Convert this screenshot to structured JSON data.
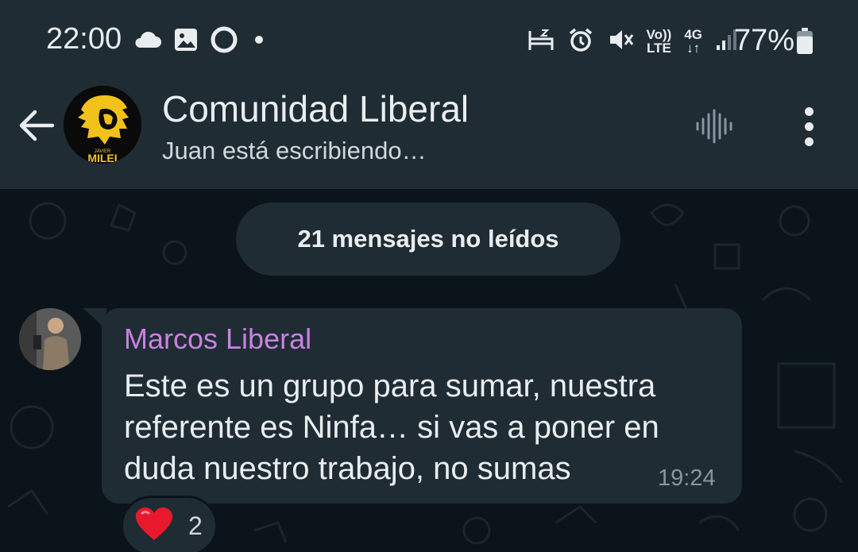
{
  "status_bar": {
    "time": "22:00",
    "left_icons": [
      "cloud-icon",
      "image-icon",
      "circle-icon",
      "dot-icon"
    ],
    "right_icons": [
      "bed-icon",
      "alarm-icon",
      "mute-icon",
      "volte-icon",
      "4g-icon",
      "signal-icon"
    ],
    "volte_top": "Vo))",
    "volte_bottom": "LTE",
    "network_top": "4G",
    "network_bottom": "↓↑",
    "battery": "77%",
    "battery_level": 0.77
  },
  "chat_header": {
    "title": "Comunidad Liberal",
    "subtitle": "Juan está escribiendo…",
    "avatar_caption_small": "JAVIER",
    "avatar_caption": "MILEI",
    "back_icon": "arrow-left-icon",
    "voice_icon": "voice-chat-icon",
    "menu_icon": "more-vert-icon"
  },
  "unread_banner": "21 mensajes no leídos",
  "messages": [
    {
      "sender": "Marcos Liberal",
      "lines": [
        "Este es un grupo para sumar, nuestra",
        "referente es Ninfa… si vas a poner en",
        "duda nuestro trabajo, no sumas"
      ],
      "time": "19:24",
      "reaction": {
        "emoji": "heart-icon",
        "count": "2"
      }
    }
  ],
  "colors": {
    "header_bg": "#1f2c34",
    "chat_bg": "#0b141a",
    "bubble_bg": "#1f2c34",
    "sender_name": "#c882e0",
    "timestamp": "#8696a0",
    "text": "#e9edef"
  }
}
